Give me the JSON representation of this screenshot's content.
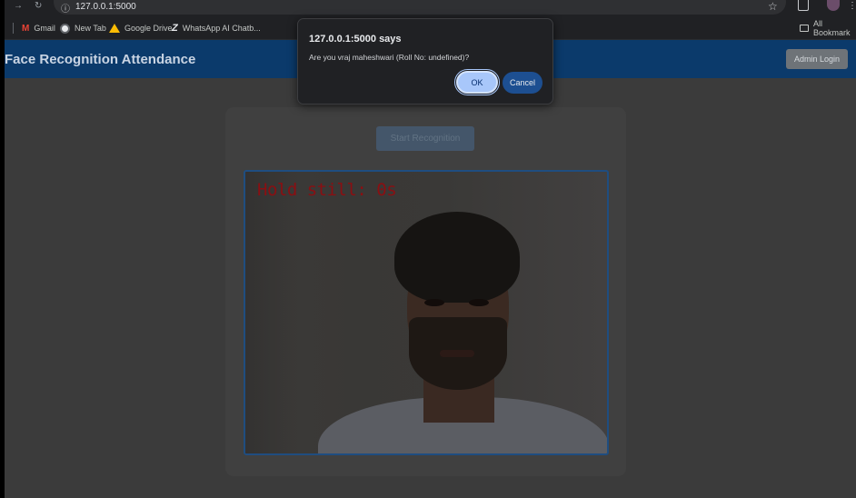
{
  "browser": {
    "url": "127.0.0.1:5000",
    "bookmarks": [
      {
        "label": "Gmail",
        "icon": "gmail-icon",
        "color": "#ea4335"
      },
      {
        "label": "New Tab",
        "icon": "chrome-icon",
        "color": "#9aa0a6"
      },
      {
        "label": "Google Drive",
        "icon": "drive-icon",
        "color": "#fbbc04"
      },
      {
        "label": "WhatsApp AI Chatb...",
        "icon": "z-icon",
        "color": "#c4c7c5"
      }
    ],
    "all_bookmarks": "All Bookmark"
  },
  "app": {
    "title": "Face Recognition Attendance",
    "admin_login": "Admin Login",
    "start_recognition": "Start Recognition",
    "overlay_text": "Hold still: 0s",
    "header_color": "#0b3a6b"
  },
  "dialog": {
    "title": "127.0.0.1:5000 says",
    "message": "Are you vraj maheshwari (Roll No: undefined)?",
    "ok": "OK",
    "cancel": "Cancel"
  }
}
